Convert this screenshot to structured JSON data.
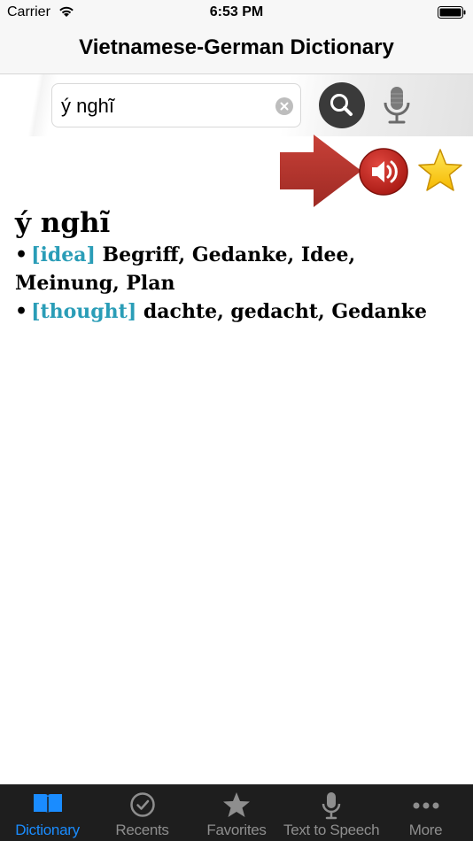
{
  "status_bar": {
    "carrier": "Carrier",
    "time": "6:53 PM"
  },
  "nav": {
    "title": "Vietnamese-German Dictionary"
  },
  "search": {
    "query": "ý nghĩ"
  },
  "entry": {
    "headword": "ý nghĩ",
    "senses": [
      {
        "tag": "[idea]",
        "translation": "Begriff, Gedanke, Idee, Meinung, Plan"
      },
      {
        "tag": "[thought]",
        "translation": "dachte, gedacht, Gedanke"
      }
    ],
    "bullet": "•"
  },
  "tabs": [
    {
      "label": "Dictionary",
      "icon": "book-icon",
      "active": true
    },
    {
      "label": "Recents",
      "icon": "clock-check-icon",
      "active": false
    },
    {
      "label": "Favorites",
      "icon": "star-icon",
      "active": false
    },
    {
      "label": "Text to Speech",
      "icon": "microphone-icon",
      "active": false
    },
    {
      "label": "More",
      "icon": "more-dots-icon",
      "active": false
    }
  ],
  "colors": {
    "accent": "#1a8cff",
    "tag": "#2a9db7",
    "speaker": "#c0221c",
    "arrow": "#b3332c",
    "star": "#ffd21a"
  }
}
